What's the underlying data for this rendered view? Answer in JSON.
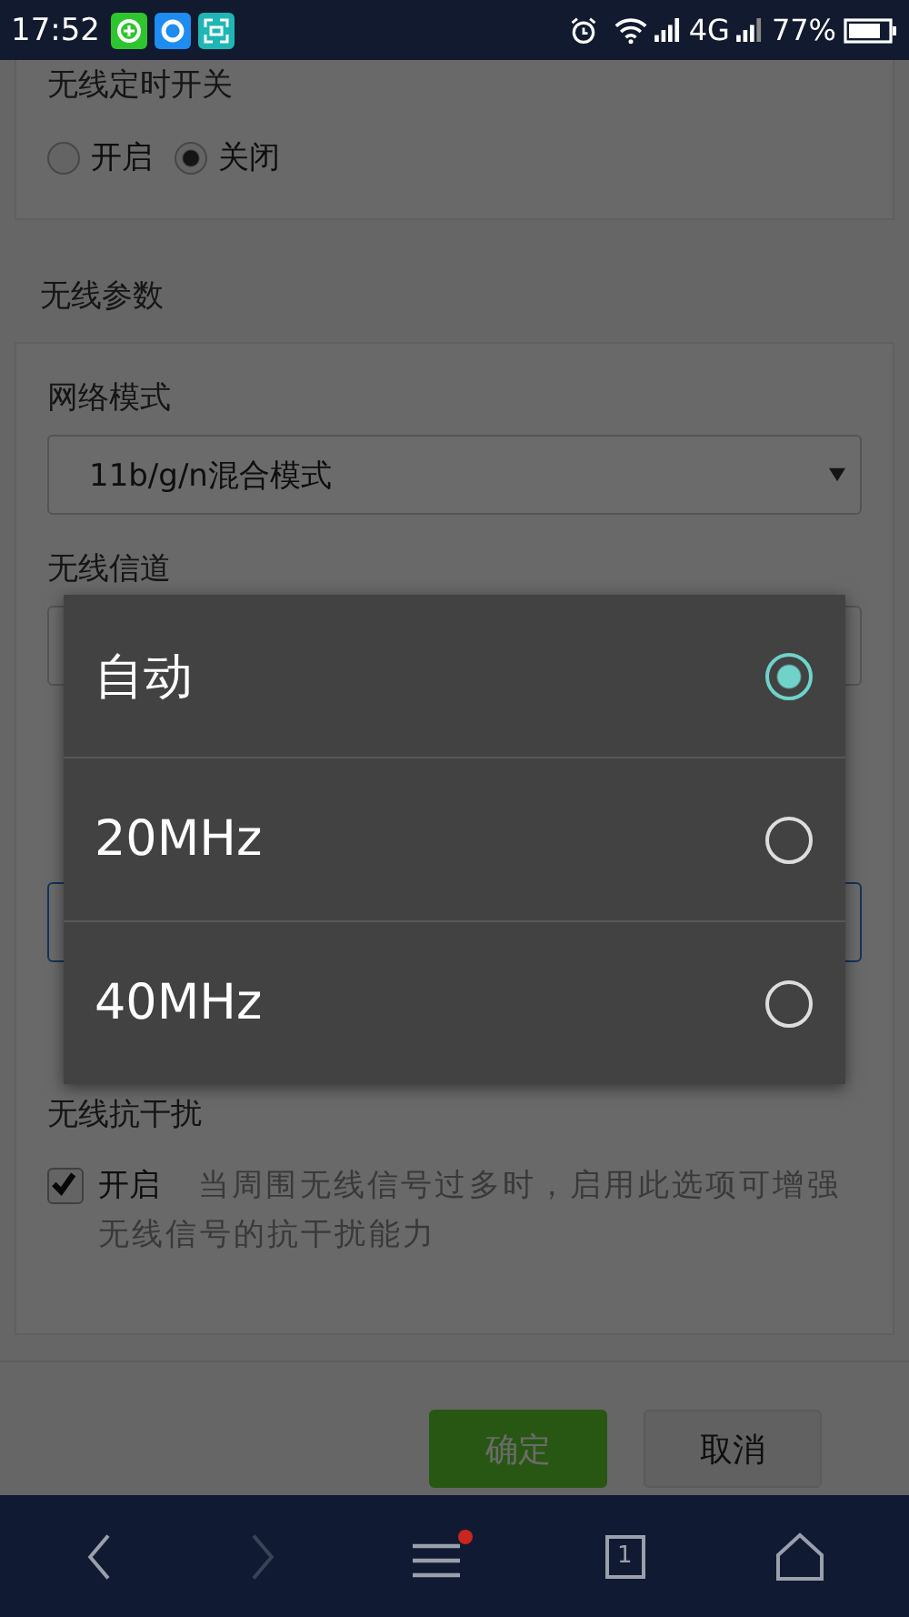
{
  "status_bar": {
    "time": "17:52",
    "network": "4G",
    "battery": "77%"
  },
  "timer_section": {
    "label": "无线定时开关",
    "options": [
      {
        "label": "开启",
        "selected": false
      },
      {
        "label": "关闭",
        "selected": true
      }
    ]
  },
  "params_heading": "无线参数",
  "params_card": {
    "fields": [
      {
        "kind": "select",
        "label": "网络模式",
        "value": "11b/g/n混合模式",
        "focused": false
      },
      {
        "kind": "select",
        "label": "无线信道",
        "focused": false
      },
      {
        "kind": "input",
        "focused": true
      }
    ],
    "interference": {
      "label": "无线抗干扰",
      "checkbox": {
        "label": "开启",
        "checked": true
      },
      "description": "当周围无线信号过多时，启用此选项可增强无线信号的抗干扰能力"
    }
  },
  "buttons": [
    {
      "label": "确定",
      "kind": "primary"
    },
    {
      "label": "取消",
      "kind": "secondary"
    }
  ],
  "dialog": {
    "options": [
      {
        "label": "自动",
        "selected": true
      },
      {
        "label": "20MHz",
        "selected": false
      },
      {
        "label": "40MHz",
        "selected": false
      }
    ]
  },
  "bottom_nav": {
    "tab_count": "1",
    "menu_badge": true,
    "forward_disabled": true
  }
}
